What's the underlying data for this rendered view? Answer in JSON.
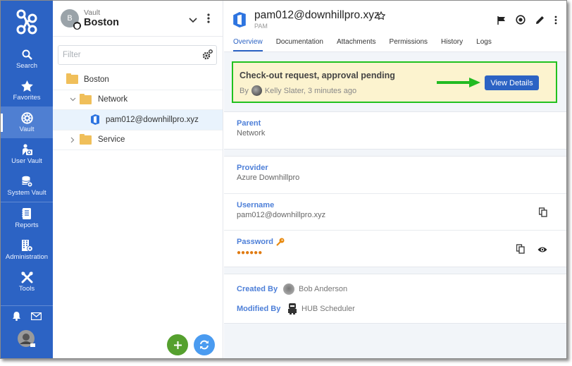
{
  "nav": {
    "items": [
      {
        "label": "Search",
        "icon": "search-icon"
      },
      {
        "label": "Favorites",
        "icon": "star-icon"
      },
      {
        "label": "Vault",
        "icon": "vault-icon",
        "active": true
      },
      {
        "label": "User Vault",
        "icon": "user-vault-icon"
      },
      {
        "label": "System Vault",
        "icon": "system-vault-icon"
      },
      {
        "label": "Reports",
        "icon": "reports-icon"
      },
      {
        "label": "Administration",
        "icon": "administration-icon"
      },
      {
        "label": "Tools",
        "icon": "tools-icon"
      }
    ],
    "brand_color": "#2c63c4"
  },
  "vault": {
    "label": "Vault",
    "name": "Boston",
    "avatar_letter": "B"
  },
  "filter": {
    "placeholder": "Filter",
    "value": ""
  },
  "tree": [
    {
      "label": "Boston",
      "type": "folder",
      "level": 0
    },
    {
      "label": "Network",
      "type": "folder",
      "level": 1,
      "expanded": true
    },
    {
      "label": "pam012@downhillpro.xyz",
      "type": "entry",
      "level": 2,
      "selected": true
    },
    {
      "label": "Service",
      "type": "folder",
      "level": 1,
      "expanded": false
    }
  ],
  "fab": {
    "add": "+",
    "refresh": "⟳"
  },
  "entry": {
    "title": "pam012@downhillpro.xyz",
    "subtitle": "PAM",
    "tabs": [
      "Overview",
      "Documentation",
      "Attachments",
      "Permissions",
      "History",
      "Logs"
    ],
    "active_tab": "Overview"
  },
  "alert": {
    "title": "Check-out request, approval pending",
    "by_prefix": "By",
    "by_text": "Kelly Slater, 3 minutes ago",
    "button": "View Details"
  },
  "fields": {
    "parent": {
      "label": "Parent",
      "value": "Network"
    },
    "provider": {
      "label": "Provider",
      "value": "Azure Downhillpro"
    },
    "username": {
      "label": "Username",
      "value": "pam012@downhillpro.xyz"
    },
    "password": {
      "label": "Password",
      "value": "●●●●●●"
    }
  },
  "meta": {
    "created_label": "Created By",
    "created_by": "Bob Anderson",
    "modified_label": "Modified By",
    "modified_by": "HUB Scheduler"
  }
}
